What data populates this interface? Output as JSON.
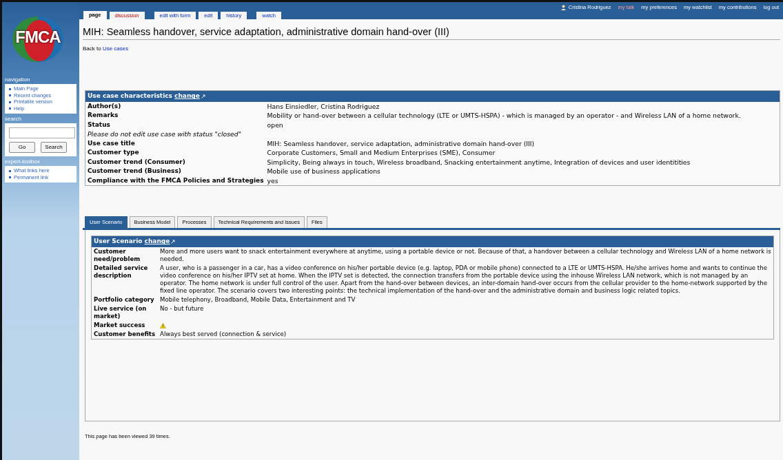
{
  "logo": {
    "text": "FMCA"
  },
  "user_bar": {
    "user": "Cristina Rodriguez",
    "links": [
      {
        "label": "my talk",
        "new_page": true
      },
      {
        "label": "my preferences",
        "new_page": false
      },
      {
        "label": "my watchlist",
        "new_page": false
      },
      {
        "label": "my contributions",
        "new_page": false
      },
      {
        "label": "log out",
        "new_page": false
      }
    ]
  },
  "page_tabs": [
    {
      "label": "page",
      "selected": true,
      "new_page": false
    },
    {
      "label": "discussion",
      "selected": false,
      "new_page": true
    },
    {
      "label": "edit with form",
      "selected": false,
      "new_page": false
    },
    {
      "label": "edit",
      "selected": false,
      "new_page": false
    },
    {
      "label": "history",
      "selected": false,
      "new_page": false
    },
    {
      "label": "watch",
      "selected": false,
      "new_page": false
    }
  ],
  "sidebar": {
    "sections": [
      {
        "kind": "links",
        "heading": "navigation",
        "items": [
          "Main Page",
          "Recent changes",
          "Printable version",
          "Help"
        ]
      },
      {
        "kind": "search",
        "heading": "search",
        "buttons": [
          "Go",
          "Search"
        ]
      },
      {
        "kind": "links",
        "heading": "expert-toolbox",
        "items": [
          "What links here",
          "Permanent link"
        ]
      }
    ]
  },
  "title": "MIH: Seamless handover, service adaptation, administrative domain hand-over (III)",
  "back_link": {
    "prefix": "Back to",
    "link": "Use cases"
  },
  "characteristics": {
    "heading": "Use case characteristics",
    "edit_link": "change",
    "rows": [
      {
        "kind": "field",
        "label": "Author(s)",
        "value": "Hans Einsiedler, Cristina Rodriguez"
      },
      {
        "kind": "field",
        "label": "Remarks",
        "value": "Mobility or hand-over between a cellular technology (LTE or UMTS-HSPA) - which is managed by an operator - and Wireless LAN of a home network."
      },
      {
        "kind": "field",
        "label": "Status",
        "value": "open"
      },
      {
        "kind": "note",
        "label": "Please do not edit use case with status \"closed\""
      },
      {
        "kind": "field",
        "label": "Use case title",
        "value": "MIH: Seamless handover, service adaptation, administrative domain hand-over (III)"
      },
      {
        "kind": "field",
        "label": "Customer type",
        "value": "Corporate Customers, Small and Medium Enterprises (SME), Consumer"
      },
      {
        "kind": "field",
        "label": "Customer trend (Consumer)",
        "value": "Simplicity, Being always in touch, Wireless broadband, Snacking entertainment anytime, Integration of devices and user identitities"
      },
      {
        "kind": "field",
        "label": "Customer trend (Business)",
        "value": "Mobile use of business applications"
      },
      {
        "kind": "field",
        "label": "Compliance with the FMCA Policies and Strategies",
        "value": "yes"
      }
    ]
  },
  "content_tabs": [
    {
      "label": "User Scenario",
      "selected": true
    },
    {
      "label": "Business Model",
      "selected": false
    },
    {
      "label": "Processes",
      "selected": false
    },
    {
      "label": "Technical Requirements and Issues",
      "selected": false
    },
    {
      "label": "Files",
      "selected": false
    }
  ],
  "scenario": {
    "heading": "User Scenario",
    "edit_link": "change",
    "rows": [
      {
        "kind": "text",
        "label": "Customer need/problem",
        "value": "More and more users want to snack entertainment everywhere at anytime, using a portable device or not. Because of that, a handover between a cellular technology and Wireless LAN of a home network is needed."
      },
      {
        "kind": "text",
        "label": "Detailed service description",
        "value": "A user, who is a passenger in a car, has a video conference on his/her portable device (e.g. laptop, PDA or mobile phone) connected to a LTE or UMTS-HSPA. He/she arrives home and wants to continue the video conference on his/her IPTV set at home. When the IPTV set is detected, the connection transfers from the portable device using the inhouse Wireless LAN network, which is not managed by an operator. The home network is under full control of the user. Apart from the hand-over between devices, an inter-domain hand-over occurs from the cellular provider to the home-network supported by the fixed line operator. The scenario covers two interesting points: the technical implementation of the hand-over and the administrative domain and business logic related topics."
      },
      {
        "kind": "text",
        "label": "Portfolio category",
        "value": "Mobile telephony, Broadband, Mobile Data, Entertainment and TV"
      },
      {
        "kind": "text",
        "label": "Live service (on market)",
        "value": "No - but future"
      },
      {
        "kind": "warning",
        "label": "Market success"
      },
      {
        "kind": "text",
        "label": "Customer benefits",
        "value": "Always best served (connection & service)"
      }
    ]
  },
  "footer": "This page has been viewed 39 times."
}
